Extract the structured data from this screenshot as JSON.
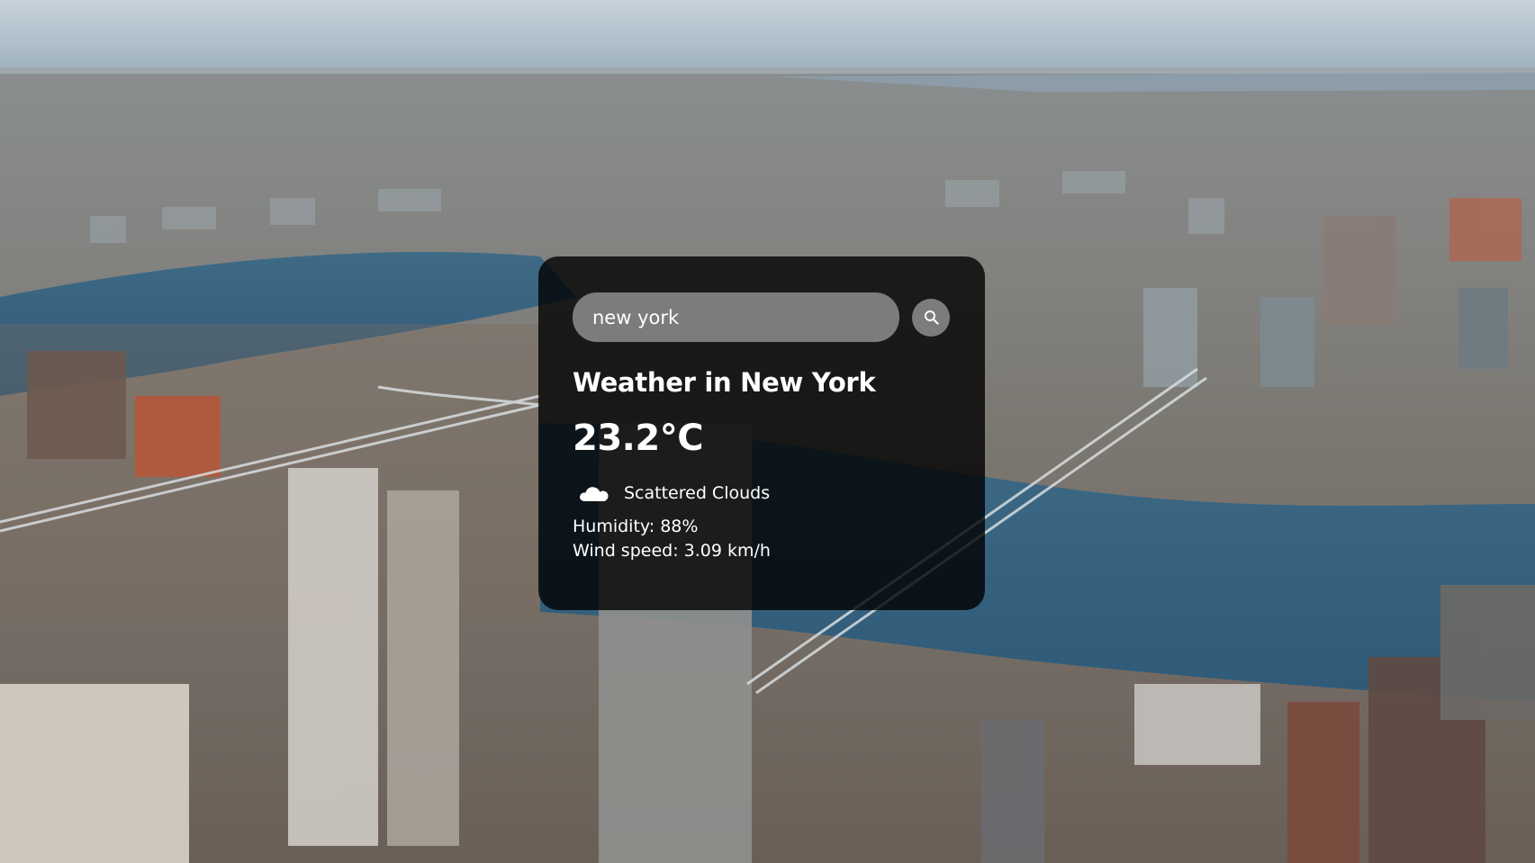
{
  "search": {
    "value": "new york",
    "icon": "search-icon"
  },
  "weather": {
    "title": "Weather in New York",
    "temperature": "23.2°C",
    "condition": "Scattered Clouds",
    "condition_icon": "cloud-icon",
    "humidity": "Humidity: 88%",
    "wind": "Wind speed: 3.09 km/h"
  },
  "colors": {
    "card_background": "#000000",
    "input_background": "#7c7c7c",
    "text": "#ffffff"
  }
}
